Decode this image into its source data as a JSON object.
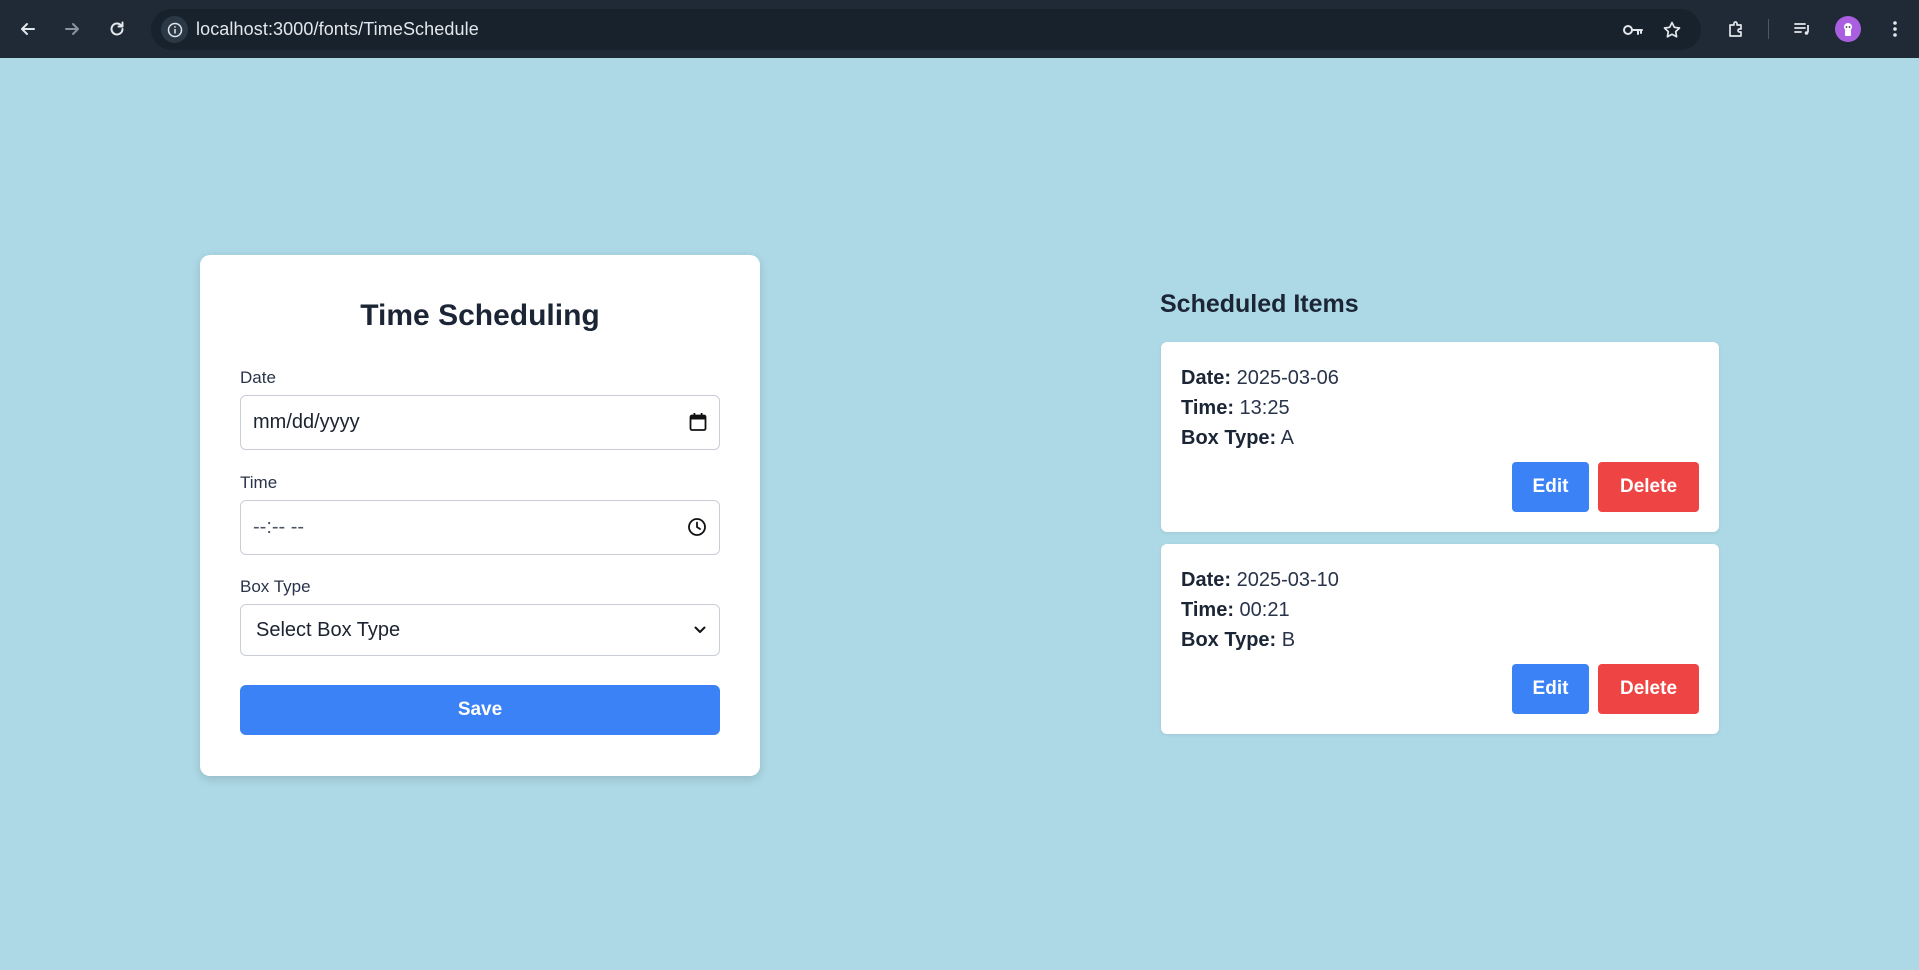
{
  "browser": {
    "url": "localhost:3000/fonts/TimeSchedule",
    "icons": [
      "back-arrow-icon",
      "forward-arrow-icon",
      "reload-icon",
      "site-info-icon",
      "key-icon",
      "star-icon",
      "extensions-icon",
      "media-queue-icon",
      "profile-avatar-icon",
      "more-vert-icon"
    ]
  },
  "form": {
    "title": "Time Scheduling",
    "date": {
      "label": "Date",
      "placeholder": "mm/dd/yyyy"
    },
    "time": {
      "label": "Time",
      "placeholder": "--:-- --"
    },
    "box_type": {
      "label": "Box Type",
      "selected": "Select Box Type"
    },
    "save_label": "Save"
  },
  "scheduled": {
    "heading": "Scheduled Items",
    "date_label": "Date:",
    "time_label": "Time:",
    "box_type_label": "Box Type:",
    "edit_label": "Edit",
    "delete_label": "Delete",
    "items": [
      {
        "date": "2025-03-06",
        "time": "13:25",
        "box_type": "A"
      },
      {
        "date": "2025-03-10",
        "time": "00:21",
        "box_type": "B"
      }
    ]
  },
  "colors": {
    "page_background": "#add8e6",
    "primary": "#3b82f6",
    "danger": "#ef4444",
    "chrome": "#1f2a36"
  }
}
